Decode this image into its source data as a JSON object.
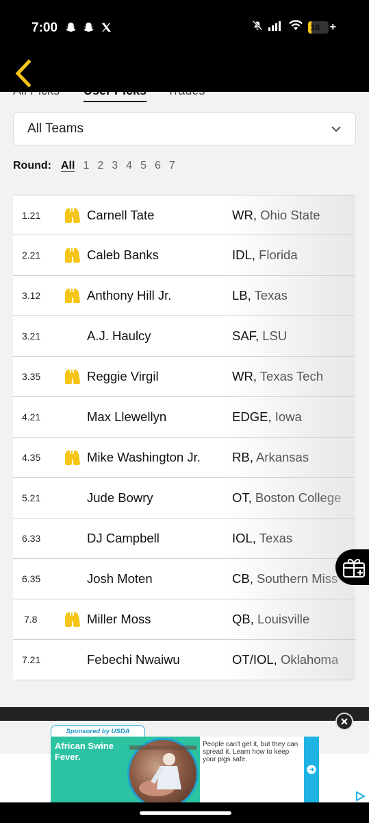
{
  "status_bar": {
    "time": "7:00",
    "battery_level": "18",
    "battery_fraction": 0.18,
    "left_icons": [
      "snapchat-icon",
      "snapchat-icon",
      "x-icon"
    ],
    "right_icons": [
      "mute-icon",
      "signal-icon",
      "wifi-icon",
      "battery-icon"
    ]
  },
  "header": {
    "back_icon": "chevron-left-icon",
    "accent_color": "#F5C518"
  },
  "tabs": [
    {
      "label": "All Picks",
      "active": false
    },
    {
      "label": "User Picks",
      "active": true
    },
    {
      "label": "Trades",
      "active": false
    }
  ],
  "team_filter": {
    "value": "All Teams",
    "icon": "chevron-down-icon"
  },
  "round_filter": {
    "label": "Round:",
    "options": [
      "All",
      "1",
      "2",
      "3",
      "4",
      "5",
      "6",
      "7"
    ],
    "selected": "All"
  },
  "picks": [
    {
      "pick": "1.21",
      "scouted": true,
      "player": "Carnell Tate",
      "position": "WR",
      "school": "Ohio State"
    },
    {
      "pick": "2.21",
      "scouted": true,
      "player": "Caleb Banks",
      "position": "IDL",
      "school": "Florida"
    },
    {
      "pick": "3.12",
      "scouted": true,
      "player": "Anthony Hill Jr.",
      "position": "LB",
      "school": "Texas"
    },
    {
      "pick": "3.21",
      "scouted": false,
      "player": "A.J. Haulcy",
      "position": "SAF",
      "school": "LSU"
    },
    {
      "pick": "3.35",
      "scouted": true,
      "player": "Reggie Virgil",
      "position": "WR",
      "school": "Texas Tech"
    },
    {
      "pick": "4.21",
      "scouted": false,
      "player": "Max Llewellyn",
      "position": "EDGE",
      "school": "Iowa"
    },
    {
      "pick": "4.35",
      "scouted": true,
      "player": "Mike Washington Jr.",
      "position": "RB",
      "school": "Arkansas"
    },
    {
      "pick": "5.21",
      "scouted": false,
      "player": "Jude Bowry",
      "position": "OT",
      "school": "Boston College"
    },
    {
      "pick": "6.33",
      "scouted": false,
      "player": "DJ Campbell",
      "position": "IOL",
      "school": "Texas"
    },
    {
      "pick": "6.35",
      "scouted": false,
      "player": "Josh Moten",
      "position": "CB",
      "school": "Southern Miss"
    },
    {
      "pick": "7.8",
      "scouted": true,
      "player": "Miller Moss",
      "position": "QB",
      "school": "Louisville"
    },
    {
      "pick": "7.21",
      "scouted": false,
      "player": "Febechi Nwaiwu",
      "position": "OT/IOL",
      "school": "Oklahoma"
    }
  ],
  "floating_button": {
    "icon": "gift-icon"
  },
  "ad": {
    "sponsor": "Sponsored by USDA",
    "headline": "African Swine Fever.",
    "body": "People can't get it, but they can spread it. Learn how to keep your pigs safe.",
    "close_icon": "close-icon",
    "cta_icon": "arrow-right-icon",
    "choices_icon": "adchoices-icon",
    "brand_color": "#2CC3A2"
  }
}
